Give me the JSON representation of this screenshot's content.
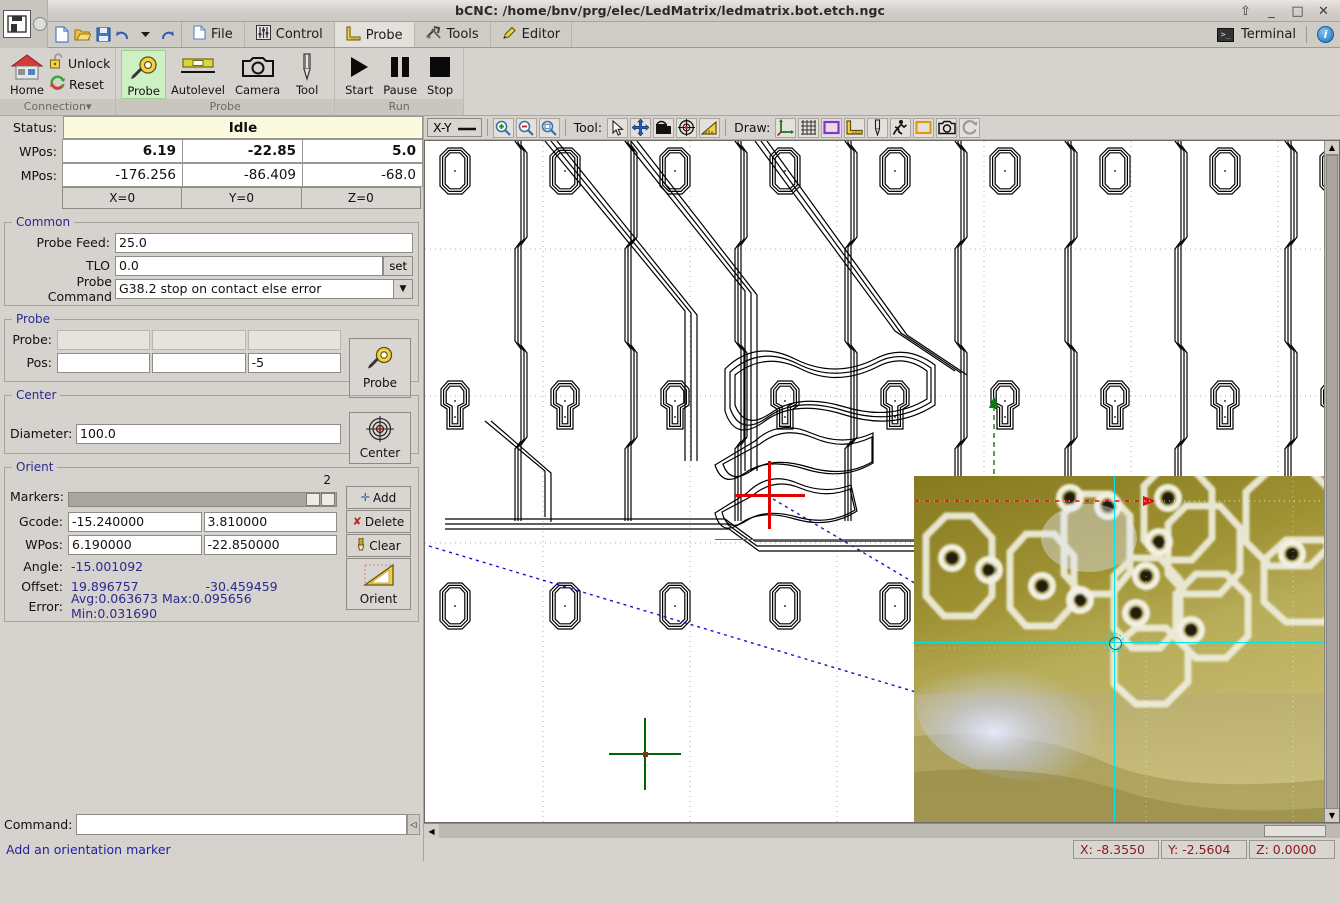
{
  "window": {
    "title": "bCNC: /home/bnv/prg/elec/LedMatrix/ledmatrix.bot.etch.ngc",
    "btn_restore": "⇧",
    "btn_minimize": "_",
    "btn_maximize": "□",
    "btn_close": "✕"
  },
  "menu": {
    "tabs": [
      {
        "label": "File",
        "icon": "file-icon"
      },
      {
        "label": "Control",
        "icon": "sliders-icon"
      },
      {
        "label": "Probe",
        "icon": "ruler-icon"
      },
      {
        "label": "Tools",
        "icon": "tools-icon"
      },
      {
        "label": "Editor",
        "icon": "pencil-icon"
      }
    ],
    "active_tab": "Probe",
    "terminal_label": "Terminal",
    "terminal_glyph": ">_",
    "info_glyph": "i",
    "quick": [
      "new-icon",
      "open-icon",
      "save-icon",
      "undo-icon",
      "undo-dropdown-icon",
      "redo-icon"
    ]
  },
  "ribbon": {
    "groups": [
      {
        "label": "Connection",
        "label_suffix": "▾",
        "big": [
          {
            "label": "Home",
            "icon": "home-icon",
            "selected": false
          }
        ],
        "small": [
          {
            "label": "Unlock",
            "icon": "padlock-open-icon"
          },
          {
            "label": "Reset",
            "icon": "reset-arrows-icon"
          }
        ]
      },
      {
        "label": "Probe",
        "big": [
          {
            "label": "Probe",
            "icon": "tape-measure-icon",
            "selected": true
          },
          {
            "label": "Autolevel",
            "icon": "level-icon",
            "selected": false
          },
          {
            "label": "Camera",
            "icon": "camera-icon",
            "selected": false
          },
          {
            "label": "Tool",
            "icon": "endmill-icon",
            "selected": false
          }
        ],
        "small": []
      },
      {
        "label": "Run",
        "big": [
          {
            "label": "Start",
            "icon": "play-icon",
            "selected": false
          },
          {
            "label": "Pause",
            "icon": "pause-icon",
            "selected": false
          },
          {
            "label": "Stop",
            "icon": "stop-icon",
            "selected": false
          }
        ],
        "small": []
      }
    ]
  },
  "status": {
    "label": "Status:",
    "value": "Idle"
  },
  "position": {
    "wpos_label": "WPos:",
    "mpos_label": "MPos:",
    "wpos": [
      "6.19",
      "-22.85",
      "5.0"
    ],
    "mpos": [
      "-176.256",
      "-86.409",
      "-68.0"
    ],
    "zero_buttons": [
      "X=0",
      "Y=0",
      "Z=0"
    ]
  },
  "common": {
    "legend": "Common",
    "probe_feed_label": "Probe Feed:",
    "probe_feed_value": "25.0",
    "tlo_label": "TLO",
    "tlo_value": "0.0",
    "set_label": "set",
    "probe_command_label": "Probe Command",
    "probe_command_value": "G38.2 stop on contact else error",
    "dropdown_glyph": "▼"
  },
  "probe": {
    "legend": "Probe",
    "probe_label": "Probe:",
    "probe_values": [
      "",
      "",
      ""
    ],
    "pos_label": "Pos:",
    "pos_values": [
      "",
      "",
      "-5"
    ],
    "button_label": "Probe",
    "button_icon": "tape-measure-icon"
  },
  "center": {
    "legend": "Center",
    "diameter_label": "Diameter:",
    "diameter_value": "100.0",
    "button_label": "Center",
    "button_icon": "crosshair-target-icon"
  },
  "orient": {
    "legend": "Orient",
    "markers_label": "Markers:",
    "markers_count": "2",
    "gcode_label": "Gcode:",
    "gcode_values": [
      "-15.240000",
      "3.810000"
    ],
    "wpos_label": "WPos:",
    "wpos_values": [
      "6.190000",
      "-22.850000"
    ],
    "angle_label": "Angle:",
    "angle_value": "-15.001092",
    "offset_label": "Offset:",
    "offset_values": [
      "19.896757",
      "-30.459459"
    ],
    "error_label": "Error:",
    "error_value": "Avg:0.063673  Max:0.095656  Min:0.031690",
    "add_label": "Add",
    "add_glyph": "✛",
    "delete_label": "Delete",
    "delete_glyph": "✘",
    "clear_label": "Clear",
    "clear_glyph": "🖌",
    "orient_button_label": "Orient",
    "orient_button_icon": "set-square-icon"
  },
  "command": {
    "label": "Command:",
    "value": "",
    "placeholder": ""
  },
  "statusline": {
    "text": "Add an orientation marker"
  },
  "canvas_toolbar": {
    "plane_label": "X-Y",
    "plane_icon": "horizontal-line-icon",
    "zoom_in_icon": "zoom-in-icon",
    "zoom_out_icon": "zoom-out-icon",
    "zoom_fit_icon": "zoom-fit-icon",
    "tool_label": "Tool:",
    "tool_icons": [
      "select-arrow-icon",
      "pan-move-icon",
      "gantry-icon",
      "origin-target-icon",
      "ruler-angle-icon"
    ],
    "draw_label": "Draw:",
    "draw_icons": [
      "axes-icon",
      "grid-icon",
      "margin-rect-icon",
      "probe-ruler-icon",
      "endmill-icon",
      "path-run-icon",
      "workarea-rect-icon",
      "camera-icon",
      "refresh-icon"
    ]
  },
  "bottom_coords": {
    "x": "X: -8.3550",
    "y": "Y: -2.5604",
    "z": "Z: 0.0000"
  },
  "colors": {
    "accent_blue": "#2a2a8e",
    "status_bg": "#fcfade",
    "selected_green": "#cdf0c5",
    "coord_text": "#8b1a1a",
    "crosshair_cyan": "#00e5e5",
    "marker_red": "#e00000",
    "marker_magenta": "#ff00ff",
    "marker_green": "#006400",
    "path_blue": "#0000cd"
  }
}
